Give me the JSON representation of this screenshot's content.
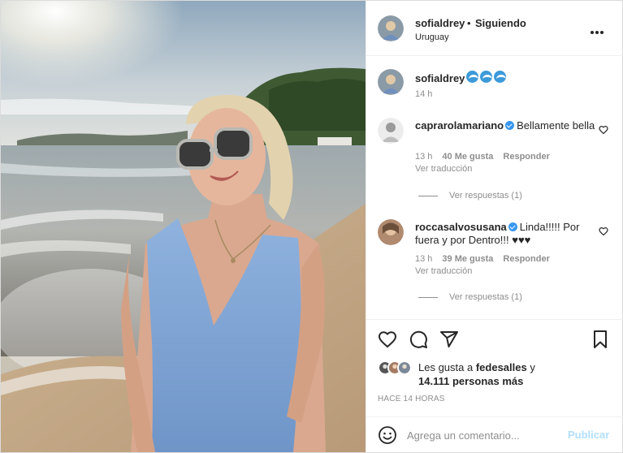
{
  "post": {
    "username": "sofialdrey",
    "separator": "•",
    "follow_status": "Siguiendo",
    "location": "Uruguay",
    "more_icon": "more-horizontal-icon"
  },
  "caption": {
    "username": "sofialdrey",
    "emoji_icons": [
      "wave-emoji",
      "wave-emoji",
      "wave-emoji"
    ],
    "time": "14 h"
  },
  "comments": [
    {
      "username": "caprarolamariano",
      "verified": true,
      "text": "Bellamente bella",
      "time": "13 h",
      "likes": "40 Me gusta",
      "reply_label": "Responder",
      "translate_label": "Ver traducción",
      "replies_label": "Ver respuestas (1)"
    },
    {
      "username": "roccasalvosusana",
      "verified": true,
      "text": "Linda!!!!! Por fuera y por Dentro!!! ♥♥♥",
      "time": "13 h",
      "likes": "39 Me gusta",
      "reply_label": "Responder",
      "translate_label": "Ver traducción",
      "replies_label": "Ver respuestas (1)"
    }
  ],
  "actions": {
    "icons": [
      "heart-icon",
      "comment-icon",
      "share-icon",
      "bookmark-icon"
    ],
    "likes_prefix": "Les gusta a",
    "likes_user": "fedesalles",
    "likes_connector": "y",
    "likes_count": "14.111 personas más",
    "posted": "HACE 14 HORAS"
  },
  "comment_box": {
    "placeholder": "Agrega un comentario...",
    "publish_label": "Publicar"
  },
  "colors": {
    "verified": "#3897f0",
    "publish_disabled": "#b2dffc",
    "muted_text": "#8e8e8e",
    "swimsuit": "#7fa6d6"
  }
}
